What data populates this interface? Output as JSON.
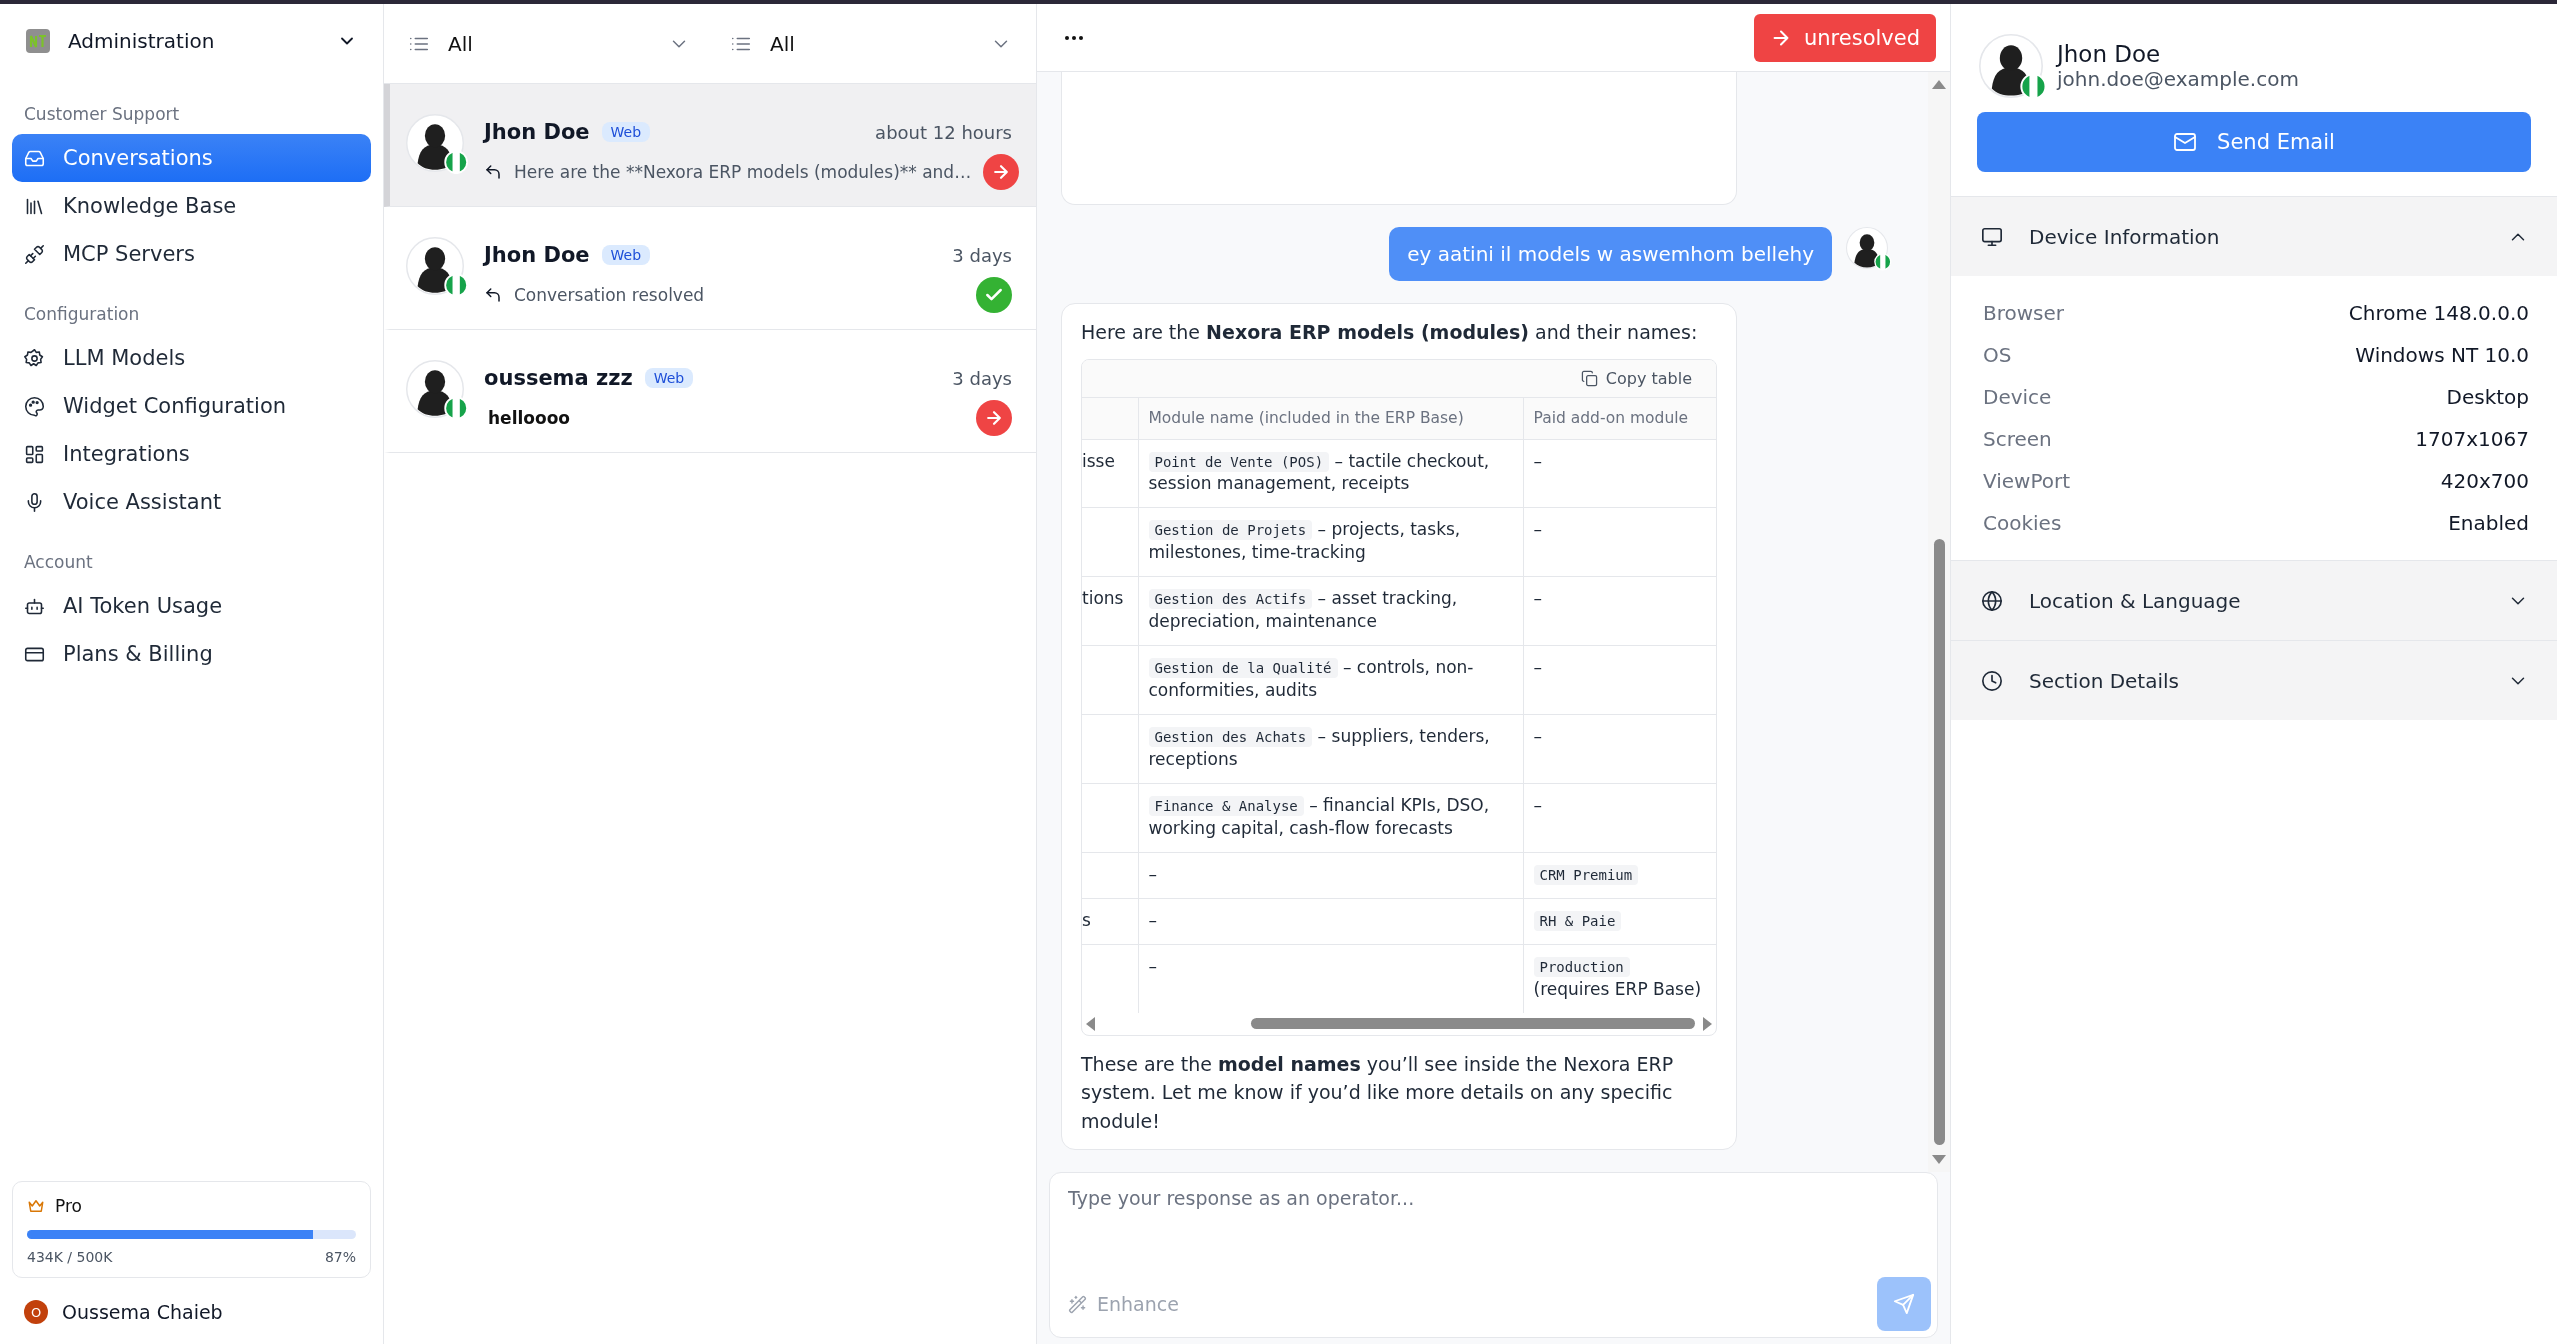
{
  "sidebar": {
    "workspace": "Administration",
    "sections": [
      {
        "title": "Customer Support",
        "items": [
          {
            "label": "Conversations",
            "selected": true
          },
          {
            "label": "Knowledge Base",
            "selected": false
          },
          {
            "label": "MCP Servers",
            "selected": false
          }
        ]
      },
      {
        "title": "Configuration",
        "items": [
          {
            "label": "LLM Models",
            "selected": false
          },
          {
            "label": "Widget Configuration",
            "selected": false
          },
          {
            "label": "Integrations",
            "selected": false
          },
          {
            "label": "Voice Assistant",
            "selected": false
          }
        ]
      },
      {
        "title": "Account",
        "items": [
          {
            "label": "AI Token Usage",
            "selected": false
          },
          {
            "label": "Plans & Billing",
            "selected": false
          }
        ]
      }
    ],
    "plan": {
      "name": "Pro",
      "level": 0.87,
      "usage": "434K / 500K",
      "percent": "87%"
    },
    "user": {
      "initial": "O",
      "name": "Oussema Chaieb"
    }
  },
  "filters": [
    {
      "label": "All"
    },
    {
      "label": "All"
    }
  ],
  "conversations": [
    {
      "name": "Jhon Doe",
      "channel": "Web",
      "time": "about 12 hours",
      "preview": "Here are the **Nexora ERP models (modules)** and…",
      "unread": false,
      "resolved": false,
      "selected": true
    },
    {
      "name": "Jhon Doe",
      "channel": "Web",
      "time": "3 days",
      "preview": "Conversation resolved",
      "unread": false,
      "resolved": true,
      "selected": false
    },
    {
      "name": "oussema zzz",
      "channel": "Web",
      "time": "3 days",
      "preview": "helloooo",
      "unread": true,
      "resolved": false,
      "selected": false
    }
  ],
  "chat": {
    "status_button": "unresolved",
    "messages": [
      {
        "kind": "user",
        "text": "ey aatini il models w aswemhom bellehy"
      },
      {
        "kind": "bot",
        "intro": "Here are the **Nexora ERP models (modules)** and their names:",
        "table": {
          "copy_label": "Copy table",
          "columns": [
            "Module name (included in the ERP Base)",
            "Paid add-on module"
          ],
          "rows": [
            {
              "column_1": "isse",
              "module": {
                "code": "Point de Vente (POS)",
                "text": " – tactile checkout, session management, receipts"
              },
              "addon": {
                "text": "–"
              }
            },
            {
              "module": {
                "code": "Gestion de Projets",
                "text": " – projects, tasks, milestones, time-tracking"
              },
              "addon": {
                "text": "–"
              }
            },
            {
              "column_1": "tions",
              "module": {
                "code": "Gestion des Actifs",
                "text": " – asset tracking, depreciation, maintenance"
              },
              "addon": {
                "text": "–"
              }
            },
            {
              "module": {
                "code": "Gestion de la Qualité",
                "text": " – controls, non-conformities, audits"
              },
              "addon": {
                "text": "–"
              }
            },
            {
              "module": {
                "code": "Gestion des Achats",
                "text": " – suppliers, tenders, receptions"
              },
              "addon": {
                "text": "–"
              }
            },
            {
              "module": {
                "code": "Finance & Analyse",
                "text": " – financial KPIs, DSO, working capital, cash-flow forecasts"
              },
              "addon": {
                "text": "–"
              }
            },
            {
              "module": {
                "text": "–"
              },
              "addon": {
                "code": "CRM Premium"
              }
            },
            {
              "column_1": "s",
              "module": {
                "text": "–"
              },
              "addon": {
                "code": "RH & Paie"
              }
            },
            {
              "module": {
                "text": "–"
              },
              "addon": {
                "code": "Production",
                "text": " (requires ERP Base)"
              }
            }
          ]
        },
        "outro": "These are the **model names** you’ll see inside the Nexora ERP system. Let me know if you’d like more details on any specific module!"
      }
    ],
    "composer": {
      "placeholder": "Type your response as an operator...",
      "enhance": "Enhance"
    }
  },
  "contact": {
    "name": "Jhon Doe",
    "email": "john.doe@example.com",
    "send_email": "Send Email",
    "sections": [
      {
        "title": "Device Information",
        "expanded": true,
        "fields": [
          {
            "label": "Browser",
            "value": "Chrome 148.0.0.0"
          },
          {
            "label": "OS",
            "value": "Windows NT 10.0"
          },
          {
            "label": "Device",
            "value": "Desktop"
          },
          {
            "label": "Screen",
            "value": "1707x1067"
          },
          {
            "label": "ViewPort",
            "value": "420x700"
          },
          {
            "label": "Cookies",
            "value": "Enabled"
          }
        ]
      },
      {
        "title": "Location & Language",
        "expanded": false
      },
      {
        "title": "Section Details",
        "expanded": false
      }
    ]
  }
}
